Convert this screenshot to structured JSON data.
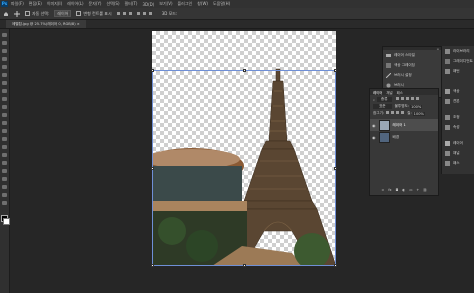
{
  "app": {
    "logo": "Ps"
  },
  "menubar": {
    "items": [
      "파일(F)",
      "편집(E)",
      "이미지(I)",
      "레이어(L)",
      "문자(Y)",
      "선택(S)",
      "필터(T)",
      "3D(D)",
      "보기(V)",
      "플러그인",
      "창(W)",
      "도움말(H)"
    ]
  },
  "options": {
    "auto_select_label": "자동 선택:",
    "auto_select_value": "레이어",
    "transform_label": "변형 컨트롤 표시",
    "mode_label": "3D 모드:"
  },
  "document": {
    "tab_title": "에펠탑.jpg @ 25.7%(레이어 0, RGB/8) ×"
  },
  "adjustments_panel": {
    "items": [
      {
        "label": "레이어 스타일",
        "icon": "layer-style-icon"
      },
      {
        "label": "색상 그레이딩",
        "icon": "gradient-icon"
      },
      {
        "label": "브러시 설정",
        "icon": "brush-icon"
      },
      {
        "label": "브러시",
        "icon": "brush-preset-icon"
      }
    ]
  },
  "layers_panel": {
    "tabs": [
      "레이어",
      "채널",
      "패스"
    ],
    "search_placeholder": "종류",
    "blend_mode": "표준",
    "opacity_label": "불투명도:",
    "opacity_value": "100%",
    "lock_label": "잠그기:",
    "fill_label": "칠:",
    "fill_value": "100%",
    "layers": [
      {
        "name": "레이어 1",
        "visible": true,
        "selected": true
      },
      {
        "name": "배경",
        "visible": true,
        "selected": false
      }
    ]
  },
  "side_panel": {
    "items": [
      {
        "label": "라이브러리",
        "icon": "library-icon"
      },
      {
        "label": "그레이디언트",
        "icon": "gradient-panel-icon"
      },
      {
        "label": "패턴",
        "icon": "pattern-icon"
      },
      {
        "label": "색상",
        "icon": "color-icon"
      },
      {
        "label": "견본",
        "icon": "swatches-icon"
      },
      {
        "label": "조정",
        "icon": "adjust-icon"
      },
      {
        "label": "속성",
        "icon": "properties-icon"
      },
      {
        "label": "레이어",
        "icon": "layers-icon"
      },
      {
        "label": "채널",
        "icon": "channels-icon"
      },
      {
        "label": "패스",
        "icon": "paths-icon"
      }
    ]
  },
  "colors": {
    "accent": "#31a8ff",
    "selection": "#6f8fd6"
  }
}
